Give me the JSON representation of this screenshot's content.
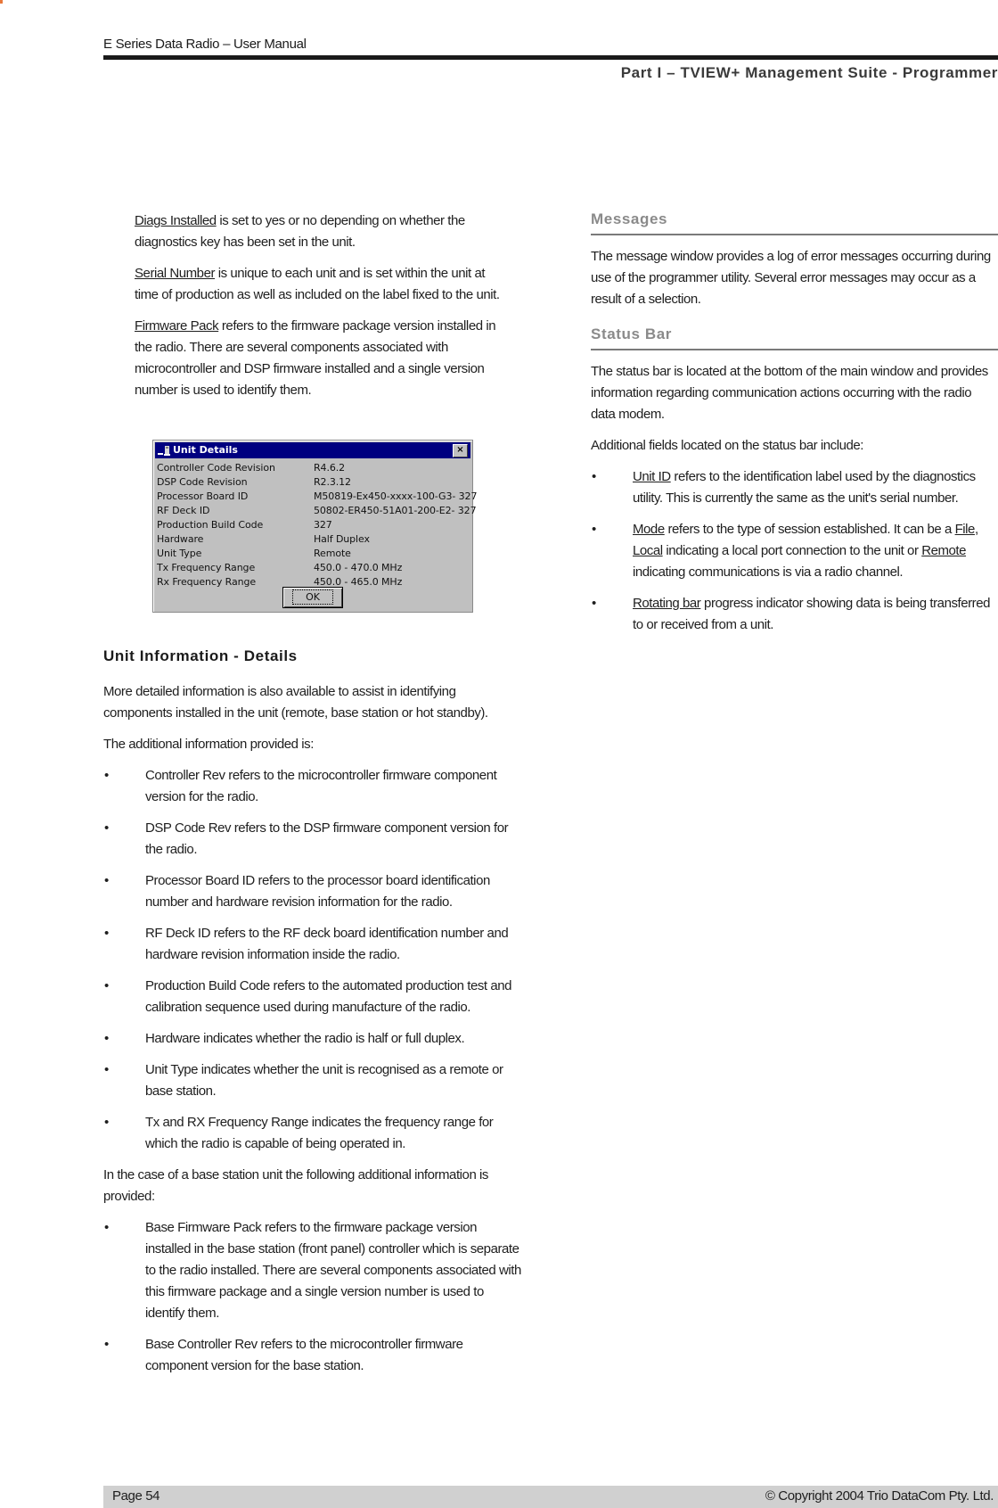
{
  "header": {
    "running_head": "E Series Data Radio – User Manual",
    "part_title": "Part I – TVIEW+ Management Suite - Programmer"
  },
  "left_top": {
    "paragraphs": [
      {
        "term": "Diags Installed",
        "text": " is set to yes or no depending on whether the diagnostics key has been set in the unit."
      },
      {
        "term": "Serial Number",
        "text": " is unique to each unit and is set within the unit at time of production as well as included on the label fixed to the unit."
      },
      {
        "term": "Firmware Pack",
        "text": " refers to the firmware package version installed in the radio. There are several components associated with microcontroller and DSP firmware installed and a single version number is used to identify them."
      }
    ]
  },
  "dialog": {
    "title": "Unit Details",
    "close_glyph": "×",
    "rows": [
      {
        "label": "Controller Code Revision",
        "value": "R4.6.2"
      },
      {
        "label": "DSP Code Revision",
        "value": "R2.3.12"
      },
      {
        "label": "Processor Board ID",
        "value": "M50819-Ex450-xxxx-100-G3- 327"
      },
      {
        "label": "RF Deck ID",
        "value": "50802-ER450-51A01-200-E2- 327"
      },
      {
        "label": "Production Build Code",
        "value": "327"
      },
      {
        "label": "Hardware",
        "value": "Half Duplex"
      },
      {
        "label": "Unit Type",
        "value": "Remote"
      },
      {
        "label": "Tx Frequency Range",
        "value": "450.0 - 470.0 MHz"
      },
      {
        "label": "Rx Frequency Range",
        "value": "450.0 - 465.0 MHz"
      }
    ],
    "ok_label": "OK"
  },
  "unit_info": {
    "heading": "Unit Information - Details",
    "intro": "More detailed information is also available to assist in identifying components installed in the unit (remote, base station or hot standby).",
    "lead": "The additional information provided is:",
    "bullets": [
      "Controller Rev refers to the microcontroller firmware component version for the radio.",
      "DSP Code Rev refers to the DSP firmware component version for the radio.",
      "Processor Board ID refers to the processor board identification number and hardware revision information for the radio.",
      "RF Deck ID refers to the RF deck board identification number and hardware revision information inside the radio.",
      "Production Build Code refers to the automated production test and calibration sequence used during manufacture of the radio.",
      "Hardware indicates whether the radio is half or full duplex.",
      "Unit Type indicates whether the unit is recognised as a remote or base station.",
      "Tx and RX  Frequency Range indicates the frequency range for which the radio is capable of being operated in."
    ],
    "base_lead": "In the case of a base station unit the following additional information is provided:",
    "base_bullets": [
      "Base Firmware Pack refers to the firmware package version installed in the base station (front panel) controller which is separate to the radio installed. There are several components associated with this firmware package and a single version number is used to identify them.",
      "Base Controller Rev refers to the microcontroller firmware component version for the base station."
    ]
  },
  "messages": {
    "heading": "Messages",
    "text": "The message window provides a log of error messages occurring during use of the programmer utility. Several error messages may occur as a result of a selection."
  },
  "status_bar": {
    "heading": "Status Bar",
    "text": "The status bar is located at the bottom of the main window and provides information regarding communication actions occurring with the radio data modem.",
    "lead": "Additional fields located on the status bar include:",
    "bullet_unit_id_term": "Unit ID",
    "bullet_unit_id_text": " refers to the identification label used by the diagnostics utility. This is currently the same as the unit's serial number.",
    "bullet_mode_term": "Mode",
    "bullet_mode_text1": " refers to the type of session established. It can be a ",
    "bullet_mode_file": "File",
    "bullet_mode_text2": ", ",
    "bullet_mode_local": "Local",
    "bullet_mode_text3": " indicating a local port connection to the unit or ",
    "bullet_mode_remote": "Remote",
    "bullet_mode_text4": " indicating communications is via a radio channel.",
    "bullet_rotating_term": "Rotating bar",
    "bullet_rotating_text": " progress indicator showing data is being transferred to or received from a unit."
  },
  "footer": {
    "page": "Page 54",
    "copyright": "© Copyright 2004 Trio DataCom Pty. Ltd."
  },
  "bullet_glyph": "•"
}
